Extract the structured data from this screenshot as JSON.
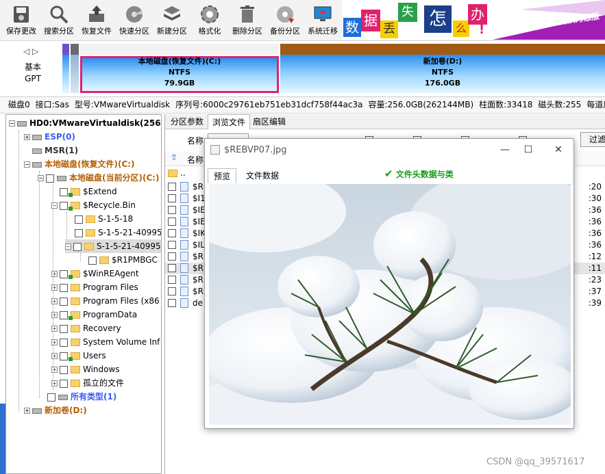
{
  "toolbar": {
    "buttons": [
      {
        "label": "保存更改",
        "icon": "save-disk-icon"
      },
      {
        "label": "搜索分区",
        "icon": "magnifier-icon"
      },
      {
        "label": "恢复文件",
        "icon": "file-restore-icon"
      },
      {
        "label": "快速分区",
        "icon": "disk-quick-icon"
      },
      {
        "label": "新建分区",
        "icon": "new-partition-icon"
      },
      {
        "label": "格式化",
        "icon": "format-icon"
      },
      {
        "label": "删除分区",
        "icon": "trash-icon"
      },
      {
        "label": "备份分区",
        "icon": "backup-icon"
      },
      {
        "label": "系统迁移",
        "icon": "system-migrate-icon"
      }
    ],
    "banner": {
      "chars": [
        "数",
        "据",
        "丢",
        "失",
        "怎",
        "么",
        "办",
        "!"
      ],
      "slogan": "DiskGenius 团队为您服"
    }
  },
  "diskmap": {
    "disk_type_line1": "基本",
    "disk_type_line2": "GPT",
    "partitions": [
      {
        "name": "本地磁盘(恢复文件)(C:)",
        "fs": "NTFS",
        "size": "79.9GB"
      },
      {
        "name": "新加卷(D:)",
        "fs": "NTFS",
        "size": "176.0GB"
      }
    ]
  },
  "infobar": {
    "disk": "磁盘0",
    "interface": "接口:Sas",
    "model": "型号:VMwareVirtualdisk",
    "serial": "序列号:6000c29761eb751eb31dcf758f44ac3a",
    "capacity": "容量:256.0GB(262144MB)",
    "cylinders": "柱面数:33418",
    "heads": "磁头数:255",
    "sectors": "每道扇区数:6"
  },
  "tree": {
    "root": "HD0:VMwareVirtualdisk(256G",
    "esp": "ESP(0)",
    "msr": "MSR(1)",
    "c_drive": "本地磁盘(恢复文件)(C:)",
    "c_current": "本地磁盘(当前分区)(C:)",
    "items": {
      "extend": "$Extend",
      "recycle": "$Recycle.Bin",
      "s1518": "S-1-5-18",
      "s1521a": "S-1-5-21-40995",
      "s1521b": "S-1-5-21-40995",
      "r1pmbgc": "$R1PMBGC",
      "winre": "$WinREAgent",
      "pf": "Program Files",
      "pf86": "Program Files (x86",
      "pd": "ProgramData",
      "recovery": "Recovery",
      "svi": "System Volume Inf",
      "users": "Users",
      "windows": "Windows",
      "orphan": "孤立的文件"
    },
    "all_types": "所有类型(1)",
    "d_drive": "新加卷(D:)"
  },
  "right": {
    "tabs": [
      "分区参数",
      "浏览文件",
      "扇区编辑"
    ],
    "filter_label": "名称:",
    "filter_button": "过滤",
    "list_header_name": "名称",
    "up_dir": "..",
    "rows": [
      {
        "name": "$R",
        "time": ":20"
      },
      {
        "name": "$I1",
        "time": ":30"
      },
      {
        "name": "$IE",
        "time": ":36"
      },
      {
        "name": "$IE",
        "time": ":36"
      },
      {
        "name": "$IK",
        "time": ":36"
      },
      {
        "name": "$IL",
        "time": ":36"
      },
      {
        "name": "$R",
        "time": ":12"
      },
      {
        "name": "$R",
        "time": ":11"
      },
      {
        "name": "$R",
        "time": ":23"
      },
      {
        "name": "$R",
        "time": ":37"
      },
      {
        "name": "de",
        "time": ":39"
      }
    ]
  },
  "dialog": {
    "title": "$REBVP07.jpg",
    "tab_preview": "预览",
    "tab_filedata": "文件数据",
    "status_message": "文件头数据与类",
    "minimize": "—",
    "maximize": "☐",
    "close": "✕"
  },
  "watermark": "CSDN @qq_39571617",
  "colors": {
    "selected_partition_border": "#e0226e",
    "partition_blue": "#2d8ff0",
    "tree_blue": "#3c5cf0",
    "tree_brown": "#b45f06",
    "banner_purple": "#a21fb5",
    "success_green": "#1a9a1a"
  }
}
